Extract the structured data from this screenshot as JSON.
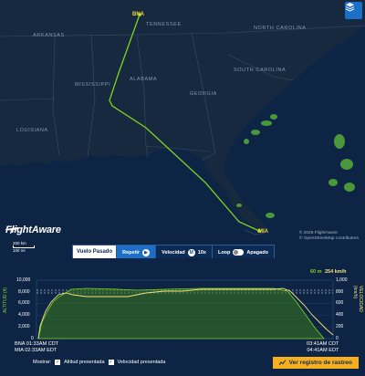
{
  "map": {
    "labels": {
      "arkansas": "Arkansas",
      "tennessee": "Tennessee",
      "north_carolina": "North Carolina",
      "mississippi": "Mississippi",
      "alabama": "Alabama",
      "georgia": "Georgia",
      "south_carolina": "South Carolina",
      "louisiana": "Louisiana"
    },
    "origin_code": "BNA",
    "destination_code": "MIA",
    "logo": "FlightAware",
    "scale_km": "200 km",
    "scale_mi": "100 mi",
    "attribution_1": "© 2026 FlightAware",
    "attribution_2": "© OpenStreetMap contributors",
    "layers_icon": "layers-icon",
    "colors": {
      "route": "#7ed321",
      "ocean": "#0d2444",
      "land": "#17293f",
      "weather": "#5fbf3a"
    }
  },
  "controls": {
    "past_flight": "Vuelo Pasado",
    "repeat": "Repetir",
    "speed_label": "Velocidad",
    "speed_value": "10x",
    "loop_label": "Loop",
    "loop_state": "Apagado"
  },
  "chart": {
    "ylabel_left": "ALTITUD (ft)",
    "ylabel_right": "VELOCIDAD (km/h)",
    "left_ticks": [
      "10,000",
      "8,000",
      "6,000",
      "4,000",
      "2,000",
      "0"
    ],
    "right_ticks": [
      "1,000",
      "800",
      "600",
      "400",
      "200",
      "0"
    ],
    "right_top_value": "254 km/h",
    "left_top_value": "60 m",
    "dep_line1": "BNA 01:33AM CDT",
    "dep_line2": "MIA 02:33AM EDT",
    "arr_line1": "03:41AM CDT",
    "arr_line2": "04:41AM EDT",
    "colors": {
      "altitude": "#7ed321",
      "speed": "#f4e27a"
    }
  },
  "bottom": {
    "show_label": "Mostrar:",
    "altitude_opt": "Altitud presentada",
    "speed_opt": "Velocidad presentada",
    "history_button": "Ver registro de rastreo"
  }
}
